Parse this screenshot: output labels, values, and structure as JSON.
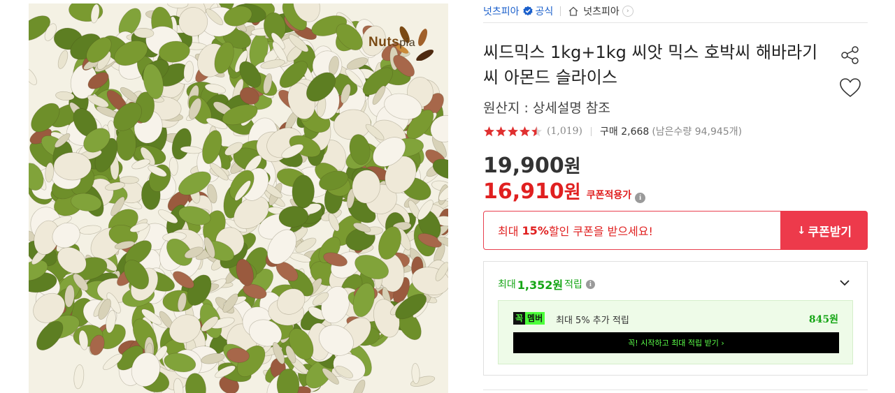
{
  "store": {
    "name": "넛츠피아",
    "official_label": "공식",
    "home_label": "넛츠피아",
    "home_chevron": "›"
  },
  "product": {
    "title": "씨드믹스 1kg+1kg 씨앗 믹스 호박씨 해바라기씨 아몬드 슬라이스",
    "origin": "원산지 : 상세설명 참조",
    "brand_logo_main": "Nuts",
    "brand_logo_sub": "pia"
  },
  "rating": {
    "score_stars": 4.5,
    "review_count": "(1,019)",
    "purchase": "구매 2,668",
    "stock": "(남은수량 94,945개)"
  },
  "price": {
    "original_number": "19,900",
    "original_unit": "원",
    "sale_number": "16,910",
    "sale_unit": "원",
    "coupon_note": "쿠폰적용가",
    "info_glyph": "i"
  },
  "coupon": {
    "prefix": "최대 ",
    "percent": "15%",
    "suffix": " 할인 쿠폰을 받으세요!",
    "button_label": "쿠폰받기",
    "button_icon": "↓"
  },
  "points": {
    "prefix": "최대 ",
    "amount": "1,352원",
    "suffix": " 적립",
    "member_badge_1": "꼭",
    "member_badge_2": "멤버",
    "member_text": "최대 5% 추가 적립",
    "member_amount": "845원",
    "member_cta": "꼭! 시작하고 최대 적립 받기 ›"
  },
  "colors": {
    "accent_red": "#e02020",
    "coupon_button": "#ed3a4b",
    "points_green": "#15a515",
    "store_blue": "#1a5fcb",
    "star": "#e03030"
  },
  "icons": [
    "verified-icon",
    "home-icon",
    "share-icon",
    "heart-icon",
    "star-icon",
    "info-icon",
    "chevron-down-icon",
    "download-icon"
  ]
}
